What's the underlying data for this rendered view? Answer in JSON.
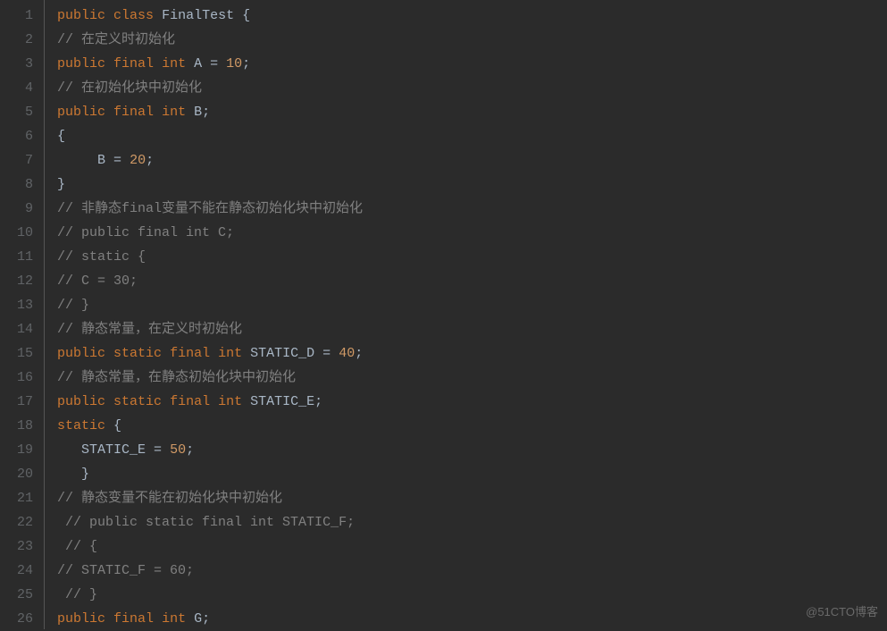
{
  "watermark": "@51CTO博客",
  "lines": [
    {
      "n": 1,
      "tokens": [
        [
          "kw",
          "public"
        ],
        [
          "s",
          " "
        ],
        [
          "kw",
          "class"
        ],
        [
          "s",
          " "
        ],
        [
          "cls",
          "FinalTest"
        ],
        [
          "s",
          " "
        ],
        [
          "punct",
          "{"
        ]
      ]
    },
    {
      "n": 2,
      "tokens": [
        [
          "cmt",
          "// 在定义时初始化"
        ]
      ]
    },
    {
      "n": 3,
      "tokens": [
        [
          "kw",
          "public"
        ],
        [
          "s",
          " "
        ],
        [
          "kw",
          "final"
        ],
        [
          "s",
          " "
        ],
        [
          "kw",
          "int"
        ],
        [
          "s",
          " "
        ],
        [
          "ident",
          "A"
        ],
        [
          "s",
          " "
        ],
        [
          "punct",
          "="
        ],
        [
          "s",
          " "
        ],
        [
          "num",
          "10"
        ],
        [
          "punct",
          ";"
        ]
      ]
    },
    {
      "n": 4,
      "tokens": [
        [
          "cmt",
          "// 在初始化块中初始化"
        ]
      ]
    },
    {
      "n": 5,
      "tokens": [
        [
          "kw",
          "public"
        ],
        [
          "s",
          " "
        ],
        [
          "kw",
          "final"
        ],
        [
          "s",
          " "
        ],
        [
          "kw",
          "int"
        ],
        [
          "s",
          " "
        ],
        [
          "ident",
          "B"
        ],
        [
          "punct",
          ";"
        ]
      ]
    },
    {
      "n": 6,
      "tokens": [
        [
          "punct",
          "{"
        ]
      ]
    },
    {
      "n": 7,
      "tokens": [
        [
          "s",
          "     "
        ],
        [
          "ident",
          "B"
        ],
        [
          "s",
          " "
        ],
        [
          "punct",
          "="
        ],
        [
          "s",
          " "
        ],
        [
          "num",
          "20"
        ],
        [
          "punct",
          ";"
        ]
      ]
    },
    {
      "n": 8,
      "tokens": [
        [
          "punct",
          "}"
        ]
      ]
    },
    {
      "n": 9,
      "tokens": [
        [
          "cmt",
          "// 非静态final变量不能在静态初始化块中初始化"
        ]
      ]
    },
    {
      "n": 10,
      "tokens": [
        [
          "cmt",
          "// public final int C;"
        ]
      ]
    },
    {
      "n": 11,
      "tokens": [
        [
          "cmt",
          "// static {"
        ]
      ]
    },
    {
      "n": 12,
      "tokens": [
        [
          "cmt",
          "// C = 30;"
        ]
      ]
    },
    {
      "n": 13,
      "tokens": [
        [
          "cmt",
          "// }"
        ]
      ]
    },
    {
      "n": 14,
      "tokens": [
        [
          "cmt",
          "// 静态常量，在定义时初始化"
        ]
      ]
    },
    {
      "n": 15,
      "tokens": [
        [
          "kw",
          "public"
        ],
        [
          "s",
          " "
        ],
        [
          "kw",
          "static"
        ],
        [
          "s",
          " "
        ],
        [
          "kw",
          "final"
        ],
        [
          "s",
          " "
        ],
        [
          "kw",
          "int"
        ],
        [
          "s",
          " "
        ],
        [
          "ident",
          "STATIC_D"
        ],
        [
          "s",
          " "
        ],
        [
          "punct",
          "="
        ],
        [
          "s",
          " "
        ],
        [
          "num",
          "40"
        ],
        [
          "punct",
          ";"
        ]
      ]
    },
    {
      "n": 16,
      "tokens": [
        [
          "cmt",
          "// 静态常量，在静态初始化块中初始化"
        ]
      ]
    },
    {
      "n": 17,
      "tokens": [
        [
          "kw",
          "public"
        ],
        [
          "s",
          " "
        ],
        [
          "kw",
          "static"
        ],
        [
          "s",
          " "
        ],
        [
          "kw",
          "final"
        ],
        [
          "s",
          " "
        ],
        [
          "kw",
          "int"
        ],
        [
          "s",
          " "
        ],
        [
          "ident",
          "STATIC_E"
        ],
        [
          "punct",
          ";"
        ]
      ]
    },
    {
      "n": 18,
      "tokens": [
        [
          "kw",
          "static"
        ],
        [
          "s",
          " "
        ],
        [
          "punct",
          "{"
        ]
      ]
    },
    {
      "n": 19,
      "tokens": [
        [
          "s",
          "   "
        ],
        [
          "ident",
          "STATIC_E"
        ],
        [
          "s",
          " "
        ],
        [
          "punct",
          "="
        ],
        [
          "s",
          " "
        ],
        [
          "num",
          "50"
        ],
        [
          "punct",
          ";"
        ]
      ]
    },
    {
      "n": 20,
      "tokens": [
        [
          "s",
          "   "
        ],
        [
          "punct",
          "}"
        ]
      ]
    },
    {
      "n": 21,
      "tokens": [
        [
          "cmt",
          "// 静态变量不能在初始化块中初始化"
        ]
      ]
    },
    {
      "n": 22,
      "tokens": [
        [
          "s",
          " "
        ],
        [
          "cmt",
          "// public static final int STATIC_F;"
        ]
      ]
    },
    {
      "n": 23,
      "tokens": [
        [
          "s",
          " "
        ],
        [
          "cmt",
          "// {"
        ]
      ]
    },
    {
      "n": 24,
      "tokens": [
        [
          "cmt",
          "// STATIC_F = 60;"
        ]
      ]
    },
    {
      "n": 25,
      "tokens": [
        [
          "s",
          " "
        ],
        [
          "cmt",
          "// }"
        ]
      ]
    },
    {
      "n": 26,
      "tokens": [
        [
          "kw",
          "public"
        ],
        [
          "s",
          " "
        ],
        [
          "kw",
          "final"
        ],
        [
          "s",
          " "
        ],
        [
          "kw",
          "int"
        ],
        [
          "s",
          " "
        ],
        [
          "ident",
          "G"
        ],
        [
          "punct",
          ";"
        ]
      ]
    }
  ]
}
